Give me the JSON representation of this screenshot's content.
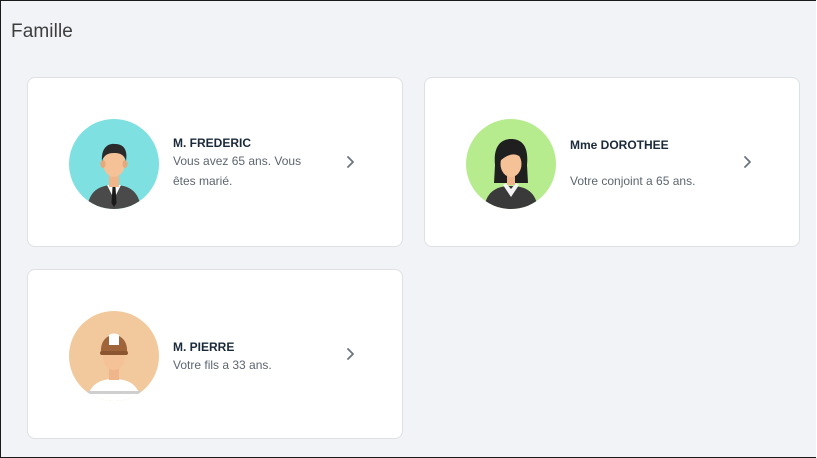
{
  "section": {
    "title": "Famille"
  },
  "members": [
    {
      "name": "M. FREDERIC",
      "desc_line1": "Vous avez 65 ans. Vous",
      "desc_line2": "êtes marié.",
      "avatar_bg": "#7ee0e0",
      "avatar_icon": "man-suit-icon"
    },
    {
      "name": "Mme DOROTHEE",
      "desc_line1": "",
      "desc_line2": "Votre conjoint a 65 ans.",
      "avatar_bg": "#b7ec8e",
      "avatar_icon": "woman-suit-icon"
    },
    {
      "name": "M. PIERRE",
      "desc_line1": "Votre fils a 33 ans.",
      "desc_line2": "",
      "avatar_bg": "#f2c99c",
      "avatar_icon": "boy-cap-icon"
    }
  ],
  "chevron_icon": "chevron-right-icon"
}
